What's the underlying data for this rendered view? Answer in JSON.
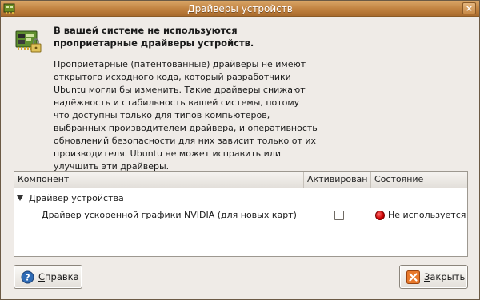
{
  "window": {
    "title": "Драйверы устройств",
    "close_glyph": "×"
  },
  "header": {
    "icon": "hardware-card-icon",
    "heading_line1": "В вашей системе не используются",
    "heading_line2": "проприетарные драйверы устройств."
  },
  "description": "Проприетарные (патентованные) драйверы не имеют\nоткрытого исходного кода, который разработчики\nUbuntu могли бы изменить. Такие драйверы снижают\nнадёжность и стабильность вашей системы, потому\nчто доступны только для типов компьютеров,\nвыбранных производителем драйвера, и оперативность\nобновлений безопасности для них зависит только от их\nпроизводителя. Ubuntu не может исправить или\nулучшить эти драйверы.",
  "table": {
    "columns": [
      "Компонент",
      "Активирован",
      "Состояние"
    ],
    "group": {
      "label": "Драйвер устройства",
      "expanded": true
    },
    "rows": [
      {
        "name": "Драйвер ускоренной графики NVIDIA (для новых карт)",
        "activated": false,
        "status": "Не используется",
        "status_color": "#cc0000"
      }
    ]
  },
  "buttons": {
    "help_prefix": "С",
    "help_rest": "правка",
    "close_prefix": "З",
    "close_rest": "акрыть"
  },
  "colors": {
    "titlebar": "#c0813f",
    "window_bg": "#efebe7",
    "status_red": "#cc0000"
  }
}
